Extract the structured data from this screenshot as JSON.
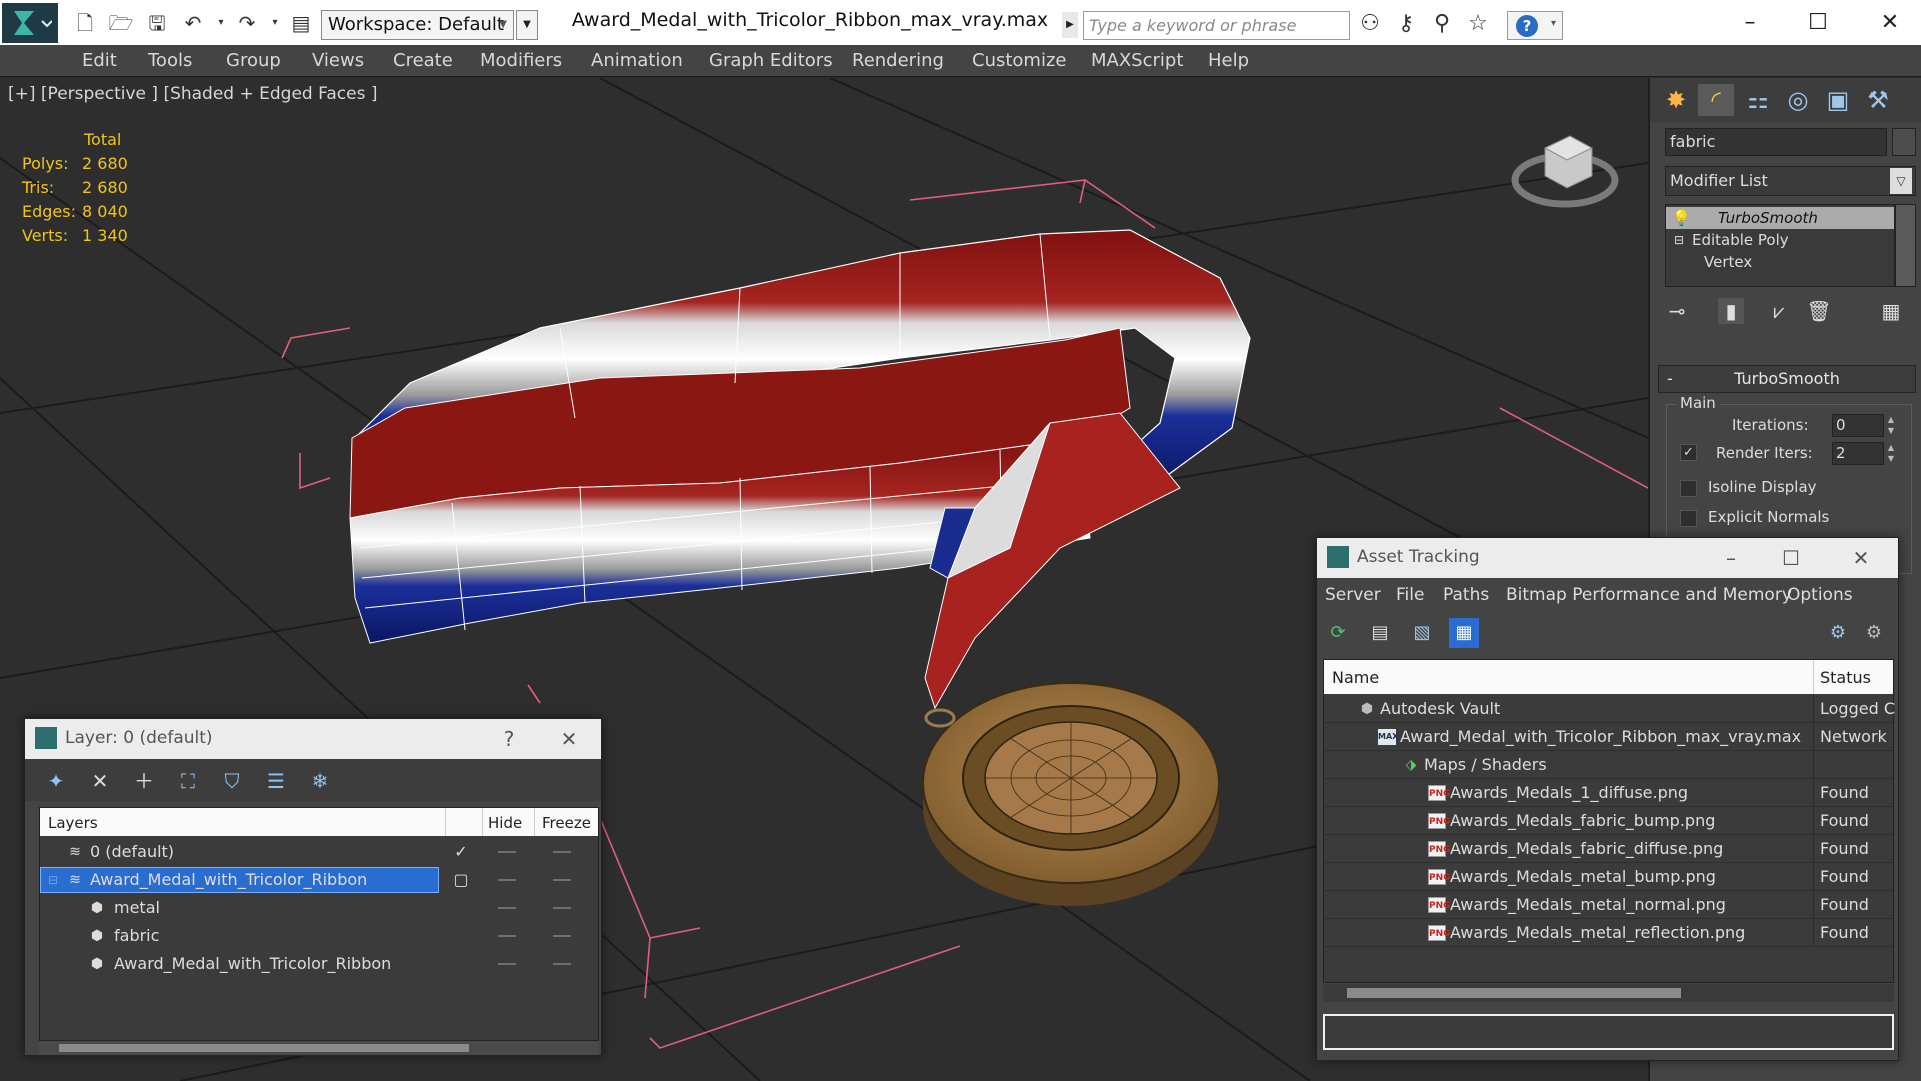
{
  "titlebar": {
    "workspace_label": "Workspace: Default",
    "document_title": "Award_Medal_with_Tricolor_Ribbon_max_vray.max",
    "search_placeholder": "Type a keyword or phrase"
  },
  "menu": [
    "Edit",
    "Tools",
    "Group",
    "Views",
    "Create",
    "Modifiers",
    "Animation",
    "Graph Editors",
    "Rendering",
    "Customize",
    "MAXScript",
    "Help"
  ],
  "viewport": {
    "label": "[+] [Perspective ] [Shaded + Edged Faces ]",
    "stats_header": "Total",
    "stats": [
      {
        "key": "Polys:",
        "value": "2 680"
      },
      {
        "key": "Tris:",
        "value": "2 680"
      },
      {
        "key": "Edges:",
        "value": "8 040"
      },
      {
        "key": "Verts:",
        "value": "1 340"
      }
    ]
  },
  "command_panel": {
    "object_name": "fabric",
    "modifier_list": "Modifier List",
    "stack": [
      "TurboSmooth",
      "Editable Poly",
      "Vertex"
    ],
    "rollout_title": "TurboSmooth",
    "group_title": "Main",
    "iterations_label": "Iterations:",
    "iterations_value": "0",
    "render_iters_label": "Render Iters:",
    "render_iters_value": "2",
    "isoline_label": "Isoline Display",
    "explicit_normals_label": "Explicit Normals"
  },
  "layer_window": {
    "title": "Layer: 0 (default)",
    "help": "?",
    "headers": {
      "layers": "Layers",
      "hide": "Hide",
      "freeze": "Freeze"
    },
    "rows": [
      {
        "name": "0 (default)",
        "checked": true
      },
      {
        "name": "Award_Medal_with_Tricolor_Ribbon",
        "selected": true
      },
      {
        "name": "metal"
      },
      {
        "name": "fabric"
      },
      {
        "name": "Award_Medal_with_Tricolor_Ribbon"
      }
    ]
  },
  "asset_window": {
    "title": "Asset Tracking",
    "menu": [
      "Server",
      "File",
      "Paths",
      "Bitmap Performance and Memory",
      "Options"
    ],
    "headers": {
      "name": "Name",
      "status": "Status"
    },
    "rows": [
      {
        "name": "Autodesk Vault",
        "status": "Logged C"
      },
      {
        "name": "Award_Medal_with_Tricolor_Ribbon_max_vray.max",
        "status": "Network"
      },
      {
        "name": "Maps / Shaders",
        "status": ""
      },
      {
        "name": "Awards_Medals_1_diffuse.png",
        "status": "Found"
      },
      {
        "name": "Awards_Medals_fabric_bump.png",
        "status": "Found"
      },
      {
        "name": "Awards_Medals_fabric_diffuse.png",
        "status": "Found"
      },
      {
        "name": "Awards_Medals_metal_bump.png",
        "status": "Found"
      },
      {
        "name": "Awards_Medals_metal_normal.png",
        "status": "Found"
      },
      {
        "name": "Awards_Medals_metal_reflection.png",
        "status": "Found"
      }
    ],
    "png_badge": "PNG"
  },
  "colors": {
    "ribbon_red": "#8f1512",
    "ribbon_blue": "#11237a",
    "medal_gold": "#a87a3e",
    "selection_blue": "#2a6dd1",
    "stats_yellow": "#f0c419"
  }
}
